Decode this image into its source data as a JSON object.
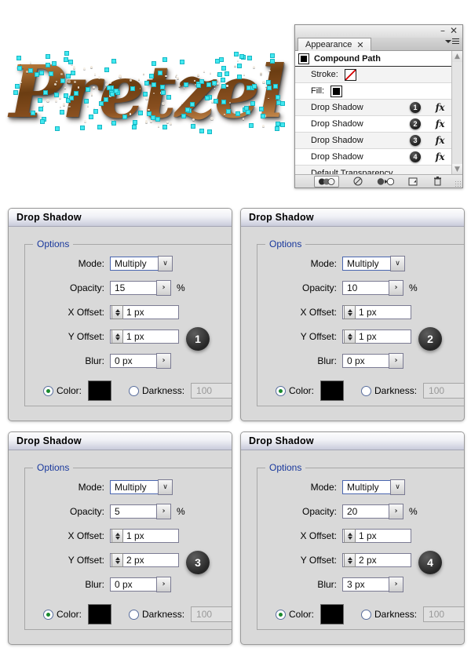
{
  "artwork": {
    "word": "Pretzel",
    "description": "pretzel-textured script lettering with selection anchor points",
    "selection_anchor_color": "#42e8f0",
    "text_gradient_top": "#c08040",
    "text_gradient_bottom": "#5d3310"
  },
  "panel": {
    "window_buttons": {
      "minimize": "–",
      "close": "✕"
    },
    "tab_label": "Appearance",
    "tab_close": "✕",
    "object_row": {
      "label": "Compound Path",
      "icon": "compound-path-icon"
    },
    "rows": [
      {
        "label": "Stroke:",
        "swatch": "none",
        "badge": "",
        "fx": ""
      },
      {
        "label": "Fill:",
        "swatch": "fill",
        "badge": "",
        "fx": ""
      },
      {
        "label": "Drop Shadow",
        "swatch": "",
        "badge": "1",
        "fx": "fx"
      },
      {
        "label": "Drop Shadow",
        "swatch": "",
        "badge": "2",
        "fx": "fx"
      },
      {
        "label": "Drop Shadow",
        "swatch": "",
        "badge": "3",
        "fx": "fx"
      },
      {
        "label": "Drop Shadow",
        "swatch": "",
        "badge": "4",
        "fx": "fx"
      },
      {
        "label": "Default Transparency",
        "swatch": "",
        "badge": "",
        "fx": ""
      }
    ],
    "scrollbar": {
      "up": "▲",
      "down": "▼"
    },
    "footer_icons": [
      "opacity-blend-toggle-icon",
      "clear-appearance-icon",
      "reduce-to-basic-appearance-icon",
      "duplicate-item-icon",
      "delete-item-icon"
    ],
    "resize_grip": "resize-grip-icon"
  },
  "dialog_common": {
    "title": "Drop Shadow",
    "legend": "Options",
    "mode_label": "Mode:",
    "opacity_label": "Opacity:",
    "x_offset_label": "X Offset:",
    "y_offset_label": "Y Offset:",
    "blur_label": "Blur:",
    "color_label": "Color:",
    "darkness_label": "Darkness:",
    "percent": "%",
    "darkness_value": "100",
    "color_swatch": "#000000",
    "dropdown_caret": "∨",
    "popup_arrow": "›"
  },
  "dialogs": [
    {
      "badge": "1",
      "mode": "Multiply",
      "opacity": "15",
      "x_offset": "1 px",
      "y_offset": "1 px",
      "blur": "0 px",
      "color_selected": true
    },
    {
      "badge": "2",
      "mode": "Multiply",
      "opacity": "10",
      "x_offset": "1 px",
      "y_offset": "1 px",
      "blur": "0 px",
      "color_selected": true
    },
    {
      "badge": "3",
      "mode": "Multiply",
      "opacity": "5",
      "x_offset": "1 px",
      "y_offset": "2 px",
      "blur": "0 px",
      "color_selected": true
    },
    {
      "badge": "4",
      "mode": "Multiply",
      "opacity": "20",
      "x_offset": "1 px",
      "y_offset": "2 px",
      "blur": "3 px",
      "color_selected": true
    }
  ]
}
